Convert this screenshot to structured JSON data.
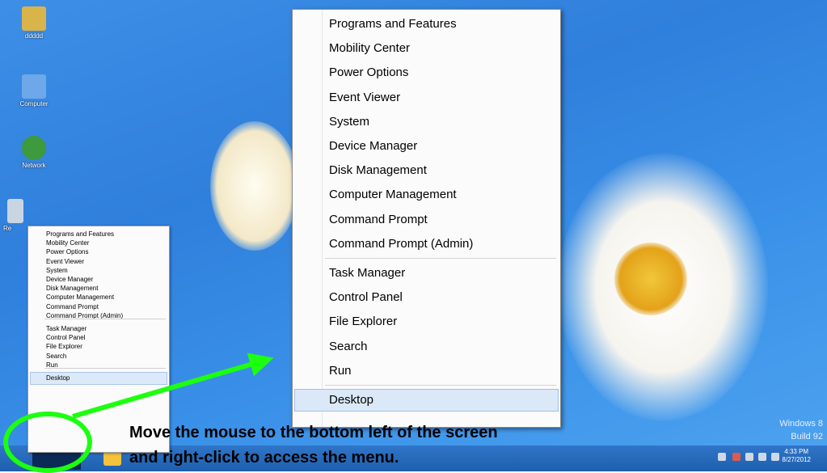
{
  "desktop": {
    "icons": [
      {
        "label": "ddddd",
        "icon": "folder-icon",
        "color": "#d9b44a"
      },
      {
        "label": "Computer",
        "icon": "computer-icon",
        "color": "#6ea8e8"
      },
      {
        "label": "Network",
        "icon": "network-globe-icon",
        "color": "#3d9a3d"
      },
      {
        "label": "Re",
        "icon": "recycle-bin-icon",
        "color": "#c9d6e2"
      }
    ],
    "watermark": [
      "Windows 8",
      "Build 92"
    ]
  },
  "small_menu": {
    "groups": [
      [
        "Programs and Features",
        "Mobility Center",
        "Power Options",
        "Event Viewer",
        "System",
        "Device Manager",
        "Disk Management",
        "Computer Management",
        "Command Prompt",
        "Command Prompt (Admin)"
      ],
      [
        "Task Manager",
        "Control Panel",
        "File Explorer",
        "Search",
        "Run"
      ],
      [
        "Desktop"
      ]
    ],
    "highlighted": "Desktop"
  },
  "big_menu": {
    "groups": [
      [
        "Programs and Features",
        "Mobility Center",
        "Power Options",
        "Event Viewer",
        "System",
        "Device Manager",
        "Disk Management",
        "Computer Management",
        "Command Prompt",
        "Command Prompt (Admin)"
      ],
      [
        "Task Manager",
        "Control Panel",
        "File Explorer",
        "Search",
        "Run"
      ],
      [
        "Desktop"
      ]
    ],
    "highlighted": "Desktop"
  },
  "taskbar": {
    "clock_time": "4:33 PM",
    "clock_date": "8/27/2012"
  },
  "annotation": {
    "line1": "Move the mouse to the bottom left of the screen",
    "line2": "and right-click to access the menu.",
    "arrow_color": "#1cff10"
  }
}
